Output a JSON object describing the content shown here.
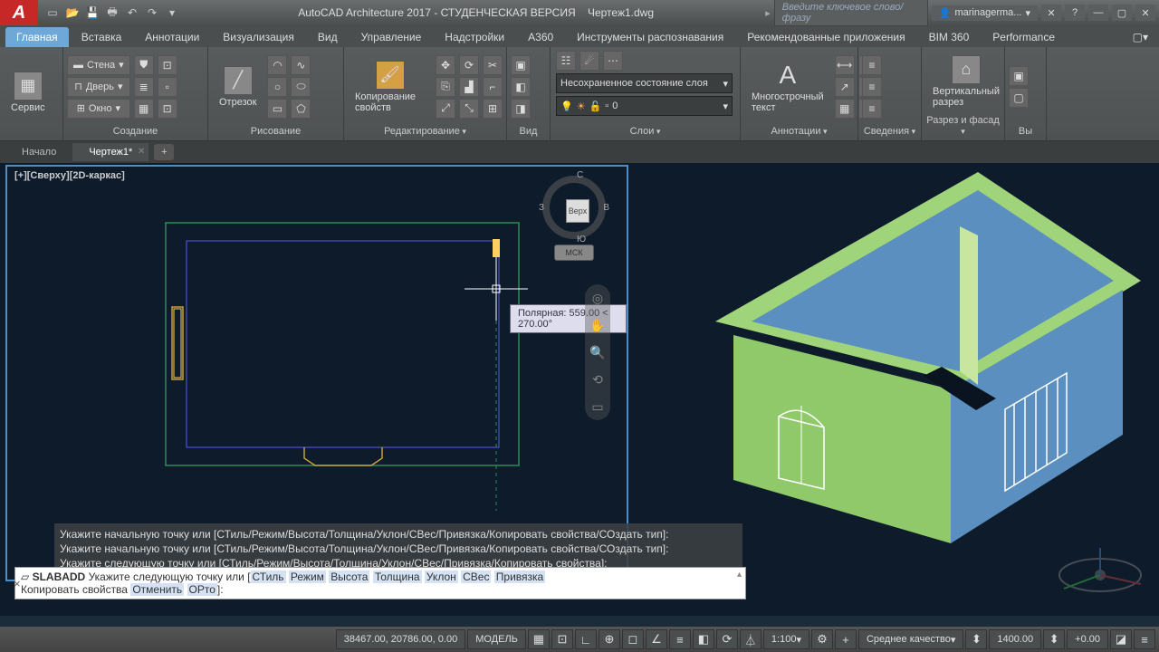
{
  "title": {
    "app": "AutoCAD Architecture 2017 - СТУДЕНЧЕСКАЯ ВЕРСИЯ",
    "doc": "Чертеж1.dwg"
  },
  "search_placeholder": "Введите ключевое слово/фразу",
  "user": "marinagerma...",
  "ribbon_tabs": [
    "Главная",
    "Вставка",
    "Аннотации",
    "Визуализация",
    "Вид",
    "Управление",
    "Надстройки",
    "A360",
    "Инструменты распознавания",
    "Рекомендованные приложения",
    "BIM 360",
    "Performance"
  ],
  "panels": {
    "service": "Сервис",
    "create": "Создание",
    "create_items": {
      "wall": "Стена",
      "door": "Дверь",
      "window": "Окно"
    },
    "draw": "Рисование",
    "draw_btn": "Отрезок",
    "edit": "Редактирование",
    "edit_btn": "Копирование свойств",
    "view": "Вид",
    "layers": "Слои",
    "layer_state": "Несохраненное состояние слоя",
    "layer_current": "0",
    "anno": "Аннотации",
    "anno_btn": "Многострочный текст",
    "info": "Сведения",
    "section": "Разрез и фасад",
    "section_btn": "Вертикальный разрез",
    "clip": "Вы"
  },
  "doc_tabs": {
    "start": "Начало",
    "d1": "Чертеж1*"
  },
  "viewport_label": "[+][Сверху][2D-каркас]",
  "viewcube": {
    "n": "С",
    "s": "Ю",
    "e": "В",
    "w": "З",
    "face": "Верх",
    "cs": "МСК"
  },
  "tooltip": "Полярная: 559.00 < 270.00°",
  "cmd_hist_1": "Укажите начальную точку или [СТиль/Режим/Высота/Толщина/Уклон/СВес/Привязка/Копировать свойства/СОздать тип]:",
  "cmd_hist_2": "Укажите начальную точку или [СТиль/Режим/Высота/Толщина/Уклон/СВес/Привязка/Копировать свойства/СОздать тип]:",
  "cmd_hist_3": "Укажите следующую точку или [СТиль/Режим/Высота/Толщина/Уклон/СВес/Привязка/Копировать свойства]:",
  "cmd_line": {
    "cmd": "SLABADD",
    "prompt": "Укажите следующую точку или [",
    "opts": [
      "СТиль",
      "Режим",
      "Высота",
      "Толщина",
      "Уклон",
      "СВес",
      "Привязка"
    ],
    "line2_pre": "Копировать свойства ",
    "line2_opts": [
      "Отменить",
      "ОРто"
    ],
    "line2_post": "]:"
  },
  "status": {
    "coords": "38467.00, 20786.00, 0.00",
    "space": "МОДЕЛЬ",
    "scale": "1:100",
    "quality": "Среднее качество",
    "val1": "1400.00",
    "val2": "+0.00"
  }
}
